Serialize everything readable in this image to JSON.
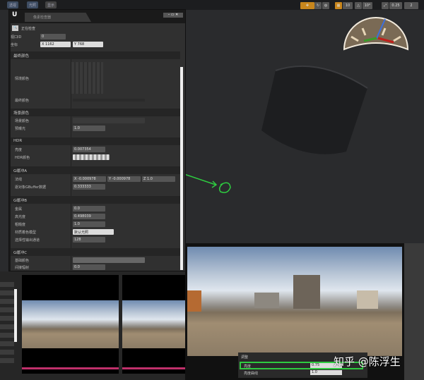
{
  "toolbar": {
    "perspective": "透视",
    "lit": "光照",
    "show": "显示",
    "grid_snap": "10",
    "rot_snap": "10°",
    "scale_snap": "0.25",
    "cam_speed": "2"
  },
  "inspector": {
    "tab_title": "像素检查器",
    "inspecting": "正在检查",
    "viewport_id_label": "视口ID",
    "viewport_id": "0",
    "coord_label": "坐标",
    "coord_x": "X 1162",
    "coord_y": "Y 768",
    "sections": {
      "final": "最终颜色",
      "context": "情境颜色",
      "final_color": "最终颜色",
      "scene": "场景颜色",
      "scene_color": "场景颜色",
      "preexposure": "预曝光",
      "preexposure_val": "1.0",
      "hdr": "HDR",
      "luminance": "亮度",
      "luminance_val": "0.007354",
      "hdr_color": "HDR颜色",
      "gbuffer_a": "G缓冲A",
      "normal": "法线",
      "normal_x": "X -0.000978",
      "normal_y": "Y -0.000978",
      "normal_z": "Z 1.0",
      "per_object": "逐对象GBuffer数据",
      "per_object_val": "0.333333",
      "gbuffer_b": "G缓冲B",
      "metallic": "金属",
      "metallic_val": "0.0",
      "specular": "高光度",
      "specular_val": "0.498039",
      "roughness": "粗糙度",
      "roughness_val": "1.0",
      "shading_model": "材质着色模型",
      "shading_model_val": "默认光照",
      "selective": "选择性输出通道",
      "selective_val": "128",
      "gbuffer_c": "G缓冲C",
      "base_color": "基础颜色",
      "indirect": "间接辐射",
      "indirect_val": "0.0"
    }
  },
  "preview": {
    "adjust": "调整",
    "brightness": "亮度",
    "brightness_val": "0.75",
    "brightness_curve": "亮度曲线",
    "brightness_curve_val": "1.0"
  },
  "watermark": "知乎 @陈浮生",
  "colors": {
    "annotation": "#2ecc40",
    "accent": "#c0306a"
  }
}
